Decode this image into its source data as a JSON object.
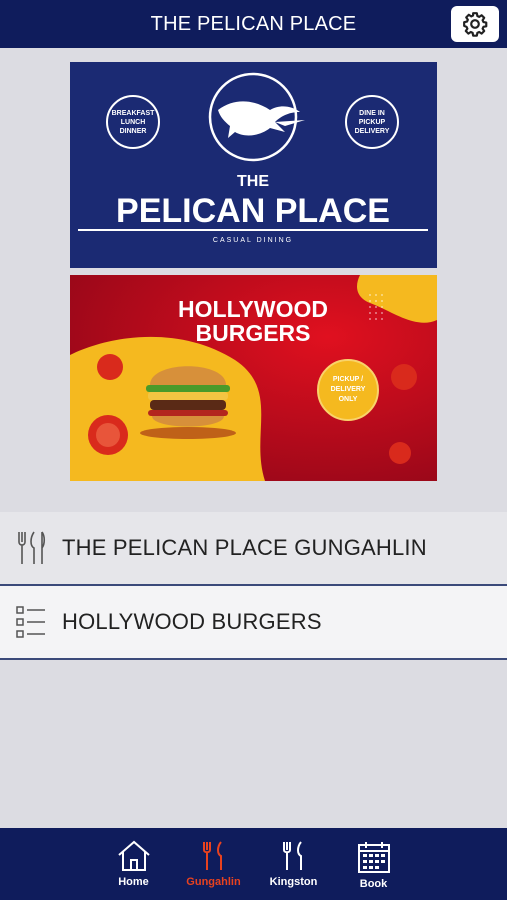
{
  "header": {
    "title": "THE PELICAN PLACE",
    "settings_icon": "gear-icon"
  },
  "banners": {
    "pelican": {
      "left_badge": [
        "BREAKFAST",
        "LUNCH",
        "DINNER"
      ],
      "right_badge": [
        "DINE IN",
        "PICKUP",
        "DELIVERY"
      ],
      "small_title": "THE",
      "big_title": "PELICAN PLACE",
      "tagline": "CASUAL DINING"
    },
    "burgers": {
      "title_line1": "HOLLYWOOD",
      "title_line2": "BURGERS",
      "badge": [
        "PICKUP /",
        "DELIVERY",
        "ONLY"
      ]
    }
  },
  "menu": {
    "items": [
      {
        "label": "THE PELICAN PLACE GUNGAHLIN",
        "icon": "cutlery-icon"
      },
      {
        "label": "HOLLYWOOD BURGERS",
        "icon": "checklist-icon"
      }
    ]
  },
  "tabs": [
    {
      "label": "Home",
      "icon": "home-icon",
      "active": false
    },
    {
      "label": "Gungahlin",
      "icon": "cutlery-icon",
      "active": true
    },
    {
      "label": "Kingston",
      "icon": "cutlery-icon",
      "active": false
    },
    {
      "label": "Book",
      "icon": "calendar-icon",
      "active": false
    }
  ],
  "colors": {
    "nav_bg": "#0f1c5c",
    "active_tab": "#e8421f",
    "page_bg": "#dcdce2"
  }
}
